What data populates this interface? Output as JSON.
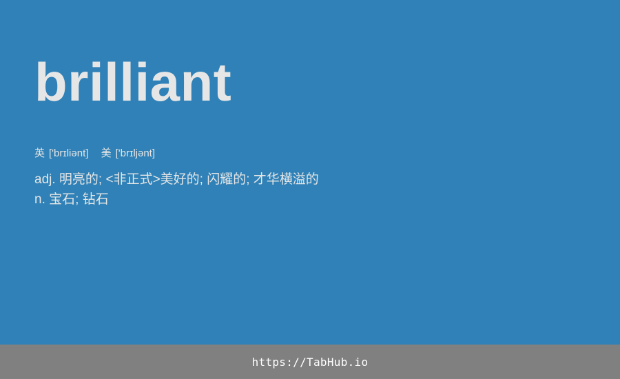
{
  "colors": {
    "card_background": "#2f81b7",
    "text": "#e6e6e6",
    "footer_background": "#808080",
    "footer_text": "#ffffff"
  },
  "entry": {
    "word": "brilliant",
    "phonetics": {
      "uk": {
        "label": "英",
        "ipa": "['brɪliənt]"
      },
      "us": {
        "label": "美",
        "ipa": "['brɪljənt]"
      }
    },
    "definitions": [
      {
        "pos": "adj.",
        "text": "明亮的; <非正式>美好的; 闪耀的; 才华横溢的"
      },
      {
        "pos": "n.",
        "text": "宝石; 钻石"
      }
    ]
  },
  "footer": {
    "link_text": "https://TabHub.io"
  }
}
